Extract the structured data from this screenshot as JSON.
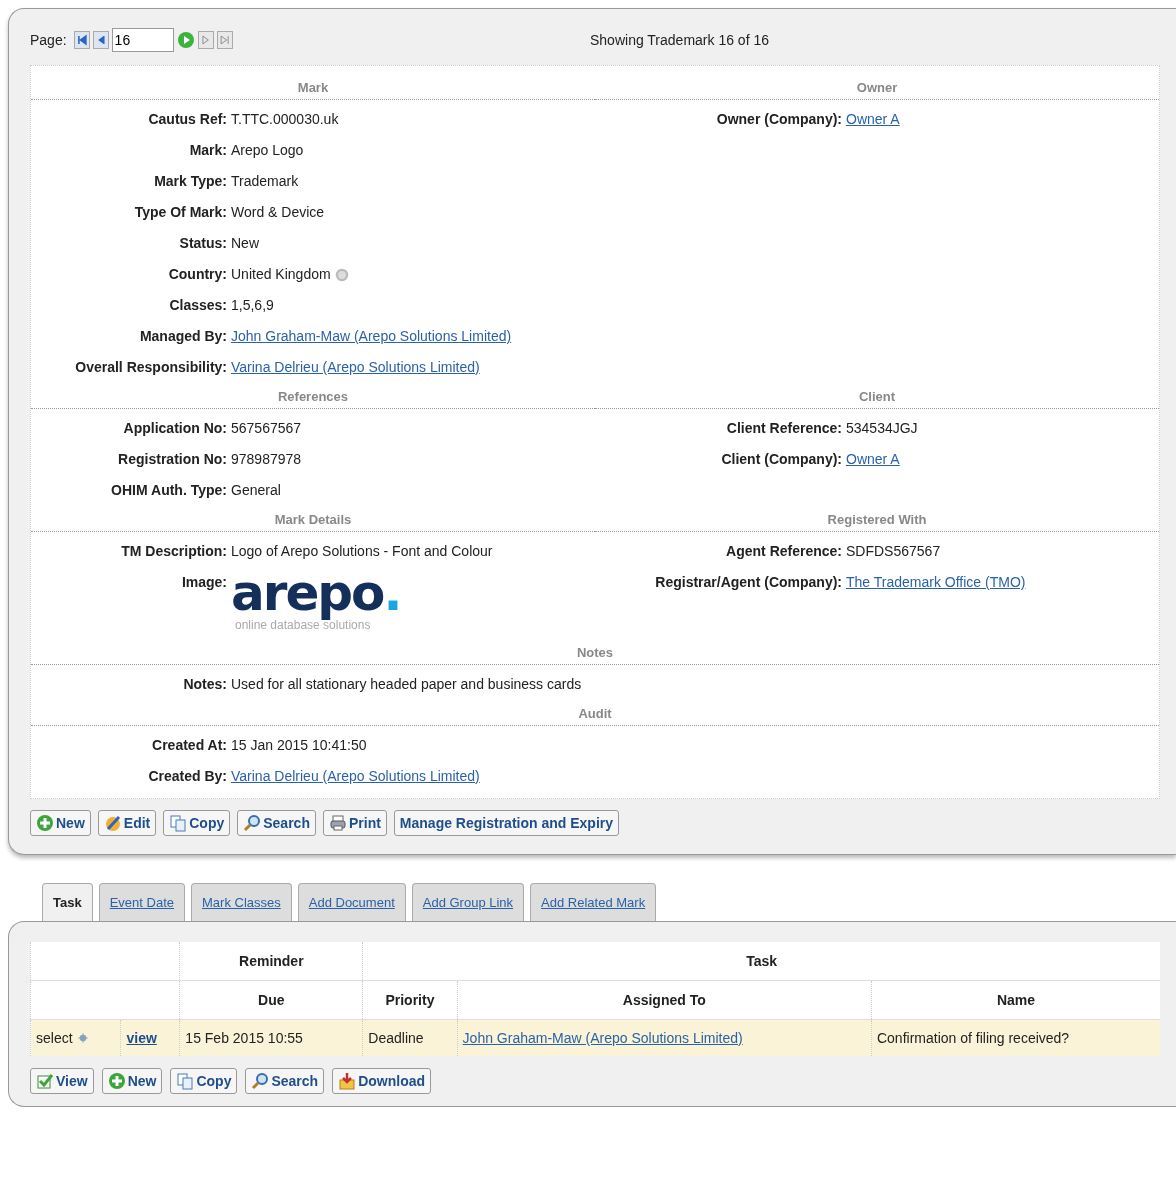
{
  "pager": {
    "label": "Page:",
    "value": "16",
    "nav": [
      {
        "kind": "first",
        "disabled": false
      },
      {
        "kind": "prev",
        "disabled": false
      },
      {
        "kind": "input"
      },
      {
        "kind": "go",
        "disabled": false
      },
      {
        "kind": "next",
        "disabled": true
      },
      {
        "kind": "last",
        "disabled": true
      }
    ],
    "status": "Showing Trademark 16 of 16"
  },
  "sections": [
    {
      "columns": [
        {
          "title": "Mark",
          "fields": [
            {
              "label": "Cautus Ref:",
              "value": "T.TTC.000030.uk",
              "kind": "text"
            },
            {
              "label": "Mark:",
              "value": "Arepo Logo",
              "kind": "text"
            },
            {
              "label": "Mark Type:",
              "value": "Trademark",
              "kind": "text"
            },
            {
              "label": "Type Of Mark:",
              "value": "Word & Device",
              "kind": "text"
            },
            {
              "label": "Status:",
              "value": "New",
              "kind": "text"
            },
            {
              "label": "Country:",
              "value": "United Kingdom",
              "kind": "text",
              "help": true
            },
            {
              "label": "Classes:",
              "value": "1,5,6,9",
              "kind": "text"
            },
            {
              "label": "Managed By:",
              "value": "John Graham-Maw (Arepo Solutions Limited)",
              "kind": "link"
            },
            {
              "label": "Overall Responsibility:",
              "value": "Varina Delrieu (Arepo Solutions Limited)",
              "kind": "link"
            }
          ]
        },
        {
          "title": "Owner",
          "fields": [
            {
              "label": "Owner (Company):",
              "value": "Owner A",
              "kind": "link"
            }
          ]
        }
      ]
    },
    {
      "columns": [
        {
          "title": "References",
          "fields": [
            {
              "label": "Application No:",
              "value": "567567567",
              "kind": "text"
            },
            {
              "label": "Registration No:",
              "value": "978987978",
              "kind": "text"
            },
            {
              "label": "OHIM Auth. Type:",
              "value": "General",
              "kind": "text"
            }
          ]
        },
        {
          "title": "Client",
          "fields": [
            {
              "label": "Client Reference:",
              "value": "534534JGJ",
              "kind": "text"
            },
            {
              "label": "Client (Company):",
              "value": "Owner A",
              "kind": "link"
            }
          ]
        }
      ]
    },
    {
      "columns": [
        {
          "title": "Mark Details",
          "fields": [
            {
              "label": "TM Description:",
              "value": "Logo of Arepo Solutions - Font and Colour",
              "kind": "text"
            },
            {
              "label": "Image:",
              "value": "arepo",
              "accent": ".",
              "tagline": "online database solutions",
              "kind": "logo"
            }
          ]
        },
        {
          "title": "Registered With",
          "fields": [
            {
              "label": "Agent Reference:",
              "value": "SDFDS567567",
              "kind": "text"
            },
            {
              "label": "Registrar/Agent (Company):",
              "value": "The Trademark Office (TMO)",
              "kind": "link"
            }
          ]
        }
      ]
    },
    {
      "columns": [
        {
          "title": "Notes",
          "fields": [
            {
              "label": "Notes:",
              "value": "Used for all stationary headed paper and business cards",
              "kind": "text"
            }
          ]
        }
      ]
    },
    {
      "columns": [
        {
          "title": "Audit",
          "fields": [
            {
              "label": "Created At:",
              "value": "15 Jan 2015 10:41:50",
              "kind": "text"
            },
            {
              "label": "Created By:",
              "value": "Varina Delrieu (Arepo Solutions Limited)",
              "kind": "link"
            }
          ]
        }
      ]
    }
  ],
  "actions": [
    {
      "label": "New",
      "kind": "add"
    },
    {
      "label": "Edit",
      "kind": "edit"
    },
    {
      "label": "Copy",
      "kind": "copy"
    },
    {
      "label": "Search",
      "kind": "search"
    },
    {
      "label": "Print",
      "kind": "print"
    },
    {
      "label": "Manage Registration and Expiry",
      "kind": "plain"
    }
  ],
  "tabs": [
    {
      "label": "Task",
      "selected": true
    },
    {
      "label": "Event Date",
      "selected": false
    },
    {
      "label": "Mark Classes",
      "selected": false
    },
    {
      "label": "Add Document",
      "selected": false
    },
    {
      "label": "Add Group Link",
      "selected": false
    },
    {
      "label": "Add Related Mark",
      "selected": false
    }
  ],
  "table": {
    "groups": [
      {
        "label": "Reminder",
        "columns": [
          "Due"
        ]
      },
      {
        "label": "Task",
        "columns": [
          "Priority",
          "Assigned To",
          "Name"
        ]
      }
    ],
    "rows": [
      {
        "select": "select",
        "view": "view",
        "cells": [
          {
            "text": "15 Feb 2015 10:55",
            "kind": "text"
          },
          {
            "text": "Deadline",
            "kind": "text"
          },
          {
            "text": "John Graham-Maw (Arepo Solutions Limited)",
            "kind": "link"
          },
          {
            "text": "Confirmation of filing received?",
            "kind": "text"
          }
        ]
      }
    ]
  },
  "table_actions": [
    {
      "label": "View",
      "kind": "view"
    },
    {
      "label": "New",
      "kind": "add"
    },
    {
      "label": "Copy",
      "kind": "copy"
    },
    {
      "label": "Search",
      "kind": "search"
    },
    {
      "label": "Download",
      "kind": "download"
    }
  ]
}
